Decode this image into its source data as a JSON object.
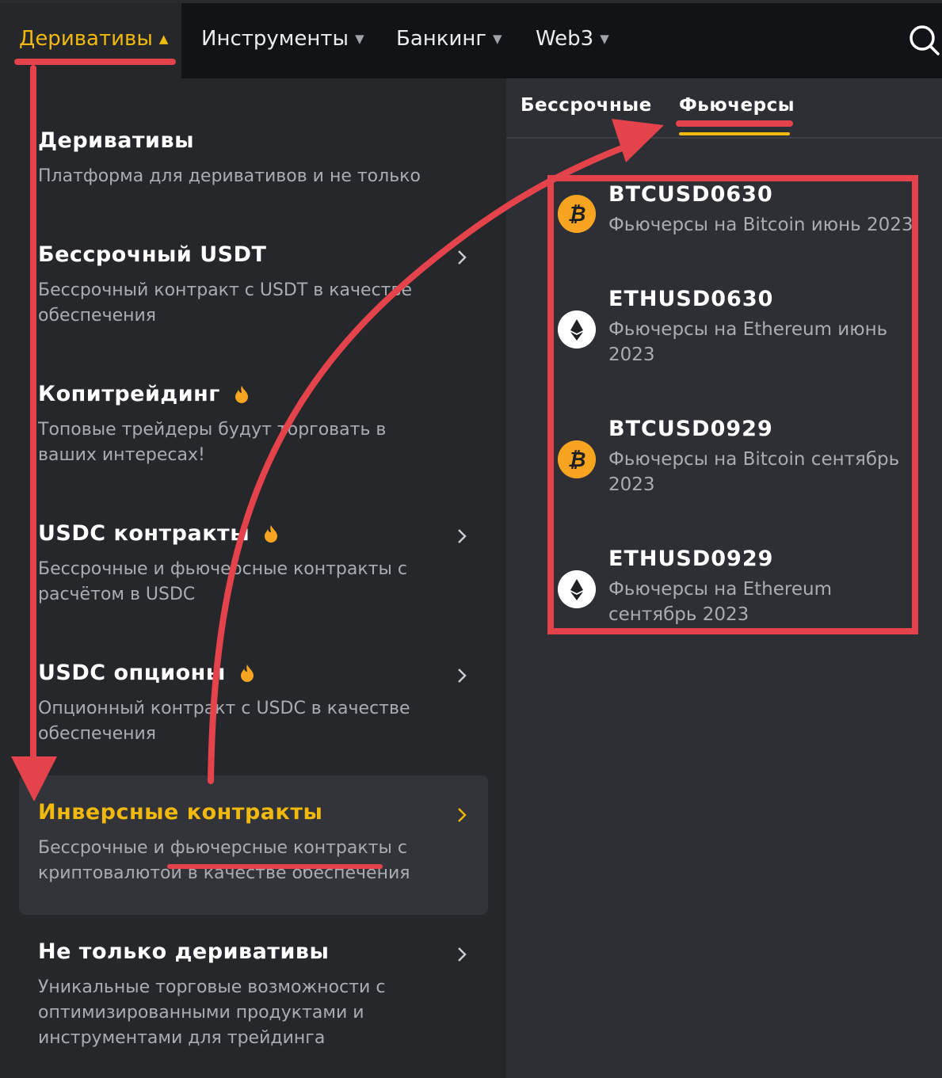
{
  "nav": {
    "items": [
      {
        "label": "Деривативы",
        "active": true
      },
      {
        "label": "Инструменты",
        "active": false
      },
      {
        "label": "Банкинг",
        "active": false
      },
      {
        "label": "Web3",
        "active": false
      }
    ]
  },
  "menu": {
    "items": [
      {
        "title": "Деривативы",
        "desc": "Платформа для деривативов и не только"
      },
      {
        "title": "Бессрочный USDT",
        "desc": "Бессрочный контракт с USDT в качестве обеспечения"
      },
      {
        "title": "Копитрейдинг",
        "desc": "Топовые трейдеры будут торговать в ваших интересах!"
      },
      {
        "title": "USDC контракты",
        "desc": "Бессрочные и фьючерсные контракты с расчётом в USDC"
      },
      {
        "title": "USDC опционы",
        "desc": "Опционный контракт с USDC в качестве обеспечения"
      },
      {
        "title": "Инверсные контракты",
        "desc": "Бессрочные и фьючерсные контракты с криптовалютой в качестве обеспечения"
      },
      {
        "title": "Не только деривативы",
        "desc": "Уникальные торговые возможности с оптимизированными продуктами и инструментами для трейдинга"
      }
    ]
  },
  "tabs": {
    "perpetual": "Бессрочные",
    "futures": "Фьючерсы"
  },
  "futures": [
    {
      "symbol": "BTCUSD0630",
      "desc": "Фьючерсы на Bitcoin июнь 2023",
      "icon": "btc-icon"
    },
    {
      "symbol": "ETHUSD0630",
      "desc": "Фьючерсы на Ethereum июнь 2023",
      "icon": "eth-icon"
    },
    {
      "symbol": "BTCUSD0929",
      "desc": "Фьючерсы на Bitcoin сентябрь 2023",
      "icon": "btc-icon"
    },
    {
      "symbol": "ETHUSD0929",
      "desc": "Фьючерсы на Ethereum сентябрь 2023",
      "icon": "eth-icon"
    }
  ],
  "colors": {
    "accent": "#f0b90b",
    "annotation": "#e5434b",
    "btc": "#f7a521"
  }
}
